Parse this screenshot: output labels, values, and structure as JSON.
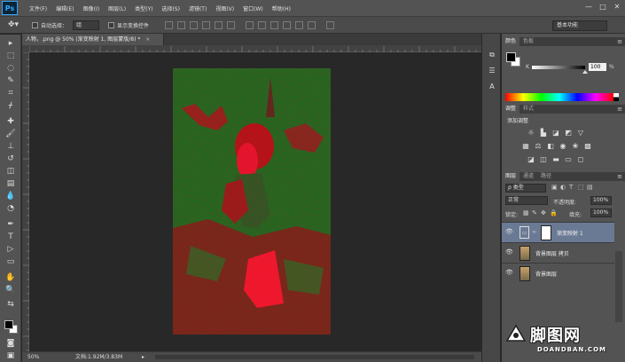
{
  "app": {
    "logo": "Ps"
  },
  "menu": [
    "文件(F)",
    "编辑(E)",
    "图像(I)",
    "图层(L)",
    "类型(Y)",
    "选择(S)",
    "滤镜(T)",
    "视图(V)",
    "窗口(W)",
    "帮助(H)"
  ],
  "window_controls": {
    "minimize": "—",
    "restore": "□",
    "close": "✕"
  },
  "options_bar": {
    "auto_select_label": "自动选择：",
    "auto_select_value": "组",
    "show_transform_label": "显示变换控件",
    "workspace": "基本功能"
  },
  "document": {
    "tab_title": "人物，.png @ 50% (渐变映射 1, 图层蒙版/8) *",
    "tab_close": "×",
    "zoom": "50%",
    "doc_size": "文档:1.92M/3.83M",
    "status_arrow": "▸"
  },
  "color_panel": {
    "tabs": [
      "颜色",
      "色板"
    ],
    "channel_label": "K",
    "value": "100",
    "unit": "%"
  },
  "adjustments_panel": {
    "tabs": [
      "调整",
      "样式"
    ],
    "title": "添加调整"
  },
  "layers_panel": {
    "tabs": [
      "图层",
      "通道",
      "路径"
    ],
    "filter_label": "ρ 类型",
    "blend_mode": "正常",
    "opacity_label": "不透明度:",
    "opacity_value": "100%",
    "lock_label": "锁定:",
    "fill_label": "填充:",
    "fill_value": "100%",
    "layers": [
      {
        "name": "渐变映射 1",
        "type": "adjustment",
        "selected": true
      },
      {
        "name": "背景图层 拷贝",
        "type": "image",
        "selected": false
      },
      {
        "name": "背景图层",
        "type": "image",
        "selected": false
      }
    ]
  },
  "watermark": {
    "text": "脚图网",
    "url": "DOANDBAN.COM"
  },
  "icons": {
    "move_tool": "move-icon",
    "eye": "eye-icon",
    "lock": "lock-icon"
  }
}
